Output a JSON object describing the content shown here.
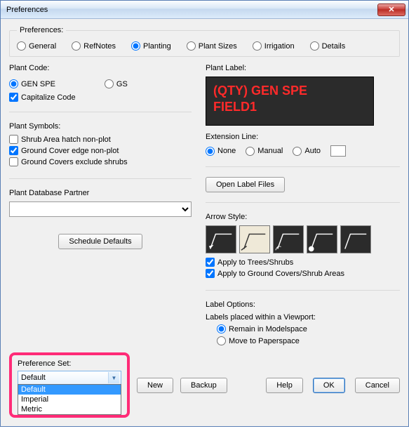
{
  "window": {
    "title": "Preferences"
  },
  "prefs_group": {
    "legend": "Preferences:",
    "options": [
      "General",
      "RefNotes",
      "Planting",
      "Plant Sizes",
      "Irrigation",
      "Details"
    ],
    "selected": "Planting"
  },
  "left": {
    "plant_code": {
      "title": "Plant Code:",
      "gen_spe": "GEN SPE",
      "gs": "GS",
      "capitalize": "Capitalize Code"
    },
    "plant_symbols": {
      "title": "Plant Symbols:",
      "shrub_hatch": "Shrub Area hatch non-plot",
      "gc_edge": "Ground Cover edge non-plot",
      "gc_excl": "Ground Covers exclude shrubs"
    },
    "db_partner": {
      "title": "Plant Database Partner",
      "value": ""
    },
    "schedule_defaults": "Schedule Defaults"
  },
  "right": {
    "plant_label": {
      "title": "Plant Label:",
      "line1": "(QTY) GEN SPE",
      "line2": "FIELD1"
    },
    "ext_line": {
      "title": "Extension Line:",
      "none": "None",
      "manual": "Manual",
      "auto": "Auto"
    },
    "open_label_files": "Open Label Files",
    "arrow_style": {
      "title": "Arrow Style:",
      "apply_trees": "Apply to Trees/Shrubs",
      "apply_gc": "Apply to Ground Covers/Shrub Areas"
    },
    "label_options": {
      "title": "Label Options:",
      "subtitle": "Labels placed within a Viewport:",
      "remain": "Remain in Modelspace",
      "move": "Move to Paperspace"
    }
  },
  "bottom": {
    "pref_set_label": "Preference Set:",
    "combo_value": "Default",
    "options": [
      "Default",
      "Imperial",
      "Metric"
    ],
    "new": "New",
    "backup": "Backup",
    "help": "Help",
    "ok": "OK",
    "cancel": "Cancel"
  }
}
